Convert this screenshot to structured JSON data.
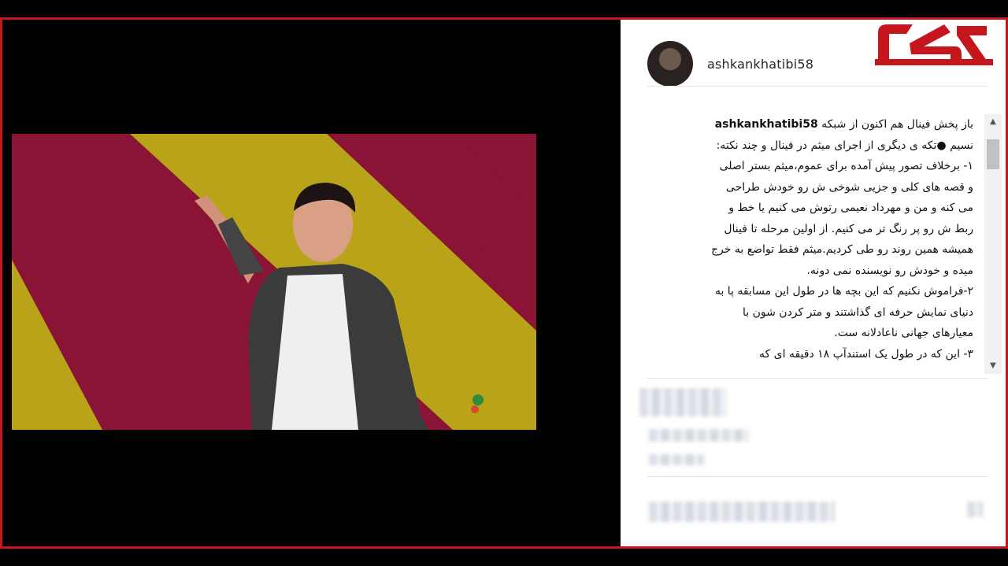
{
  "post": {
    "username": "ashkankhatibi58"
  },
  "caption": {
    "username": "ashkankhatibi58",
    "lines": [
      "باز پخش فینال هم اکنون از شبکه",
      "نسیم ●تکه ی دیگری از اجرای میثم در فینال و چند نکته:",
      "۱- برخلاف تصور پیش آمده برای عموم،میثم بستر اصلی",
      "و قصه های کلی و جزیی شوخی ش رو خودش طراحی",
      "می کنه و من و مهرداد نعیمی رتوش می کنیم یا خط و",
      "ربط ش رو پر رنگ تر می کنیم. از اولین مرحله تا فینال",
      "همیشه همین روند رو طی کردیم.میثم فقط تواضع به خرج",
      "میده و خودش رو نویسنده نمی دونه.",
      "۲-فراموش نکنیم که این بچه ها در طول این مسابقه پا به",
      "دنیای نمایش حرفه ای گذاشتند و متر کردن شون با",
      "معیارهای جهانی ناعادلانه ست.",
      "۳- این که در طول یک استندآپ ۱۸ دقیقه ای که"
    ]
  },
  "icons": {
    "avatar": "profile-photo",
    "logo": "rokna-logo",
    "scroll_up": "arrow-up-icon",
    "scroll_down": "arrow-down-icon"
  },
  "colors": {
    "frame": "#c4161c",
    "background": "#000000",
    "panel": "#ffffff"
  }
}
